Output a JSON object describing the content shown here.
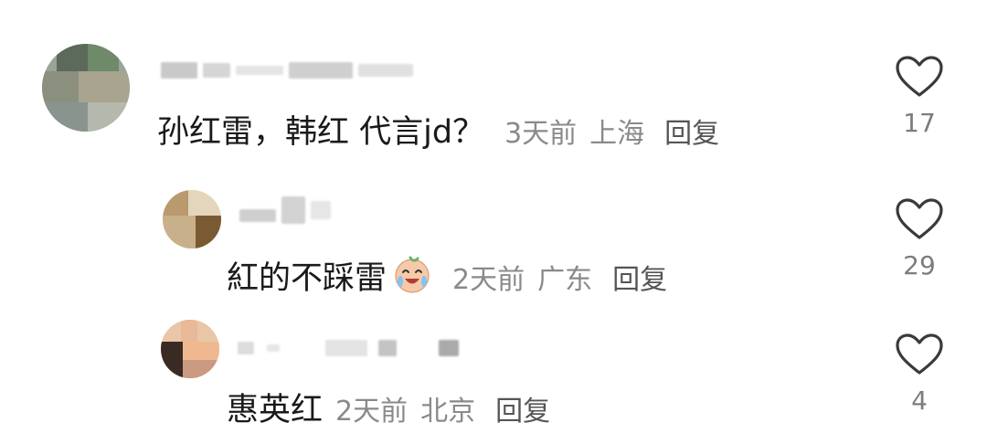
{
  "comments": [
    {
      "text": "孙红雷，韩红 代言jd？",
      "time": "3天前",
      "location": "上海",
      "reply_label": "回复",
      "likes": "17",
      "avatar_icon": "user-avatar-blurred",
      "level": "top"
    },
    {
      "text": "紅的不踩雷",
      "time": "2天前",
      "location": "广东",
      "reply_label": "回复",
      "likes": "29",
      "emoji_icon": "laughing-crying-emoji",
      "avatar_icon": "user-avatar-blurred",
      "level": "reply"
    },
    {
      "text": "惠英红",
      "time": "2天前",
      "location": "北京",
      "reply_label": "回复",
      "likes": "4",
      "avatar_icon": "user-avatar-blurred",
      "level": "reply"
    }
  ],
  "icons": {
    "like": "heart-outline-icon"
  },
  "colors": {
    "text": "#1a1a1a",
    "meta": "#8a8a8a",
    "icon_stroke": "#3a3a3a"
  }
}
